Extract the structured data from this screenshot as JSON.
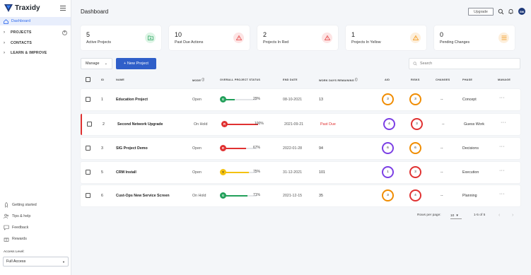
{
  "app": {
    "name": "Traxidy"
  },
  "sidebar": {
    "items": [
      {
        "label": "Dashboard"
      },
      {
        "label": "PROJECTS"
      },
      {
        "label": "CONTACTS"
      },
      {
        "label": "LEARN & IMPROVE"
      }
    ],
    "utilities": [
      {
        "label": "Getting started",
        "icon": "rocket-icon"
      },
      {
        "label": "Tips & help",
        "icon": "people-icon"
      },
      {
        "label": "Feedback",
        "icon": "chat-icon"
      },
      {
        "label": "Rewards",
        "icon": "gift-icon"
      }
    ],
    "access_label": "Access Level:",
    "access_value": "Full Access"
  },
  "header": {
    "title": "Dashboard",
    "upgrade_label": "Upgrade",
    "avatar_initials": "SM"
  },
  "cards": [
    {
      "number": "5",
      "label": "Active Projects",
      "icon": "folder-icon",
      "color": "#22a05a",
      "bg": "#def5e6"
    },
    {
      "number": "10",
      "label": "Past Due Actions",
      "icon": "warning-icon",
      "color": "#e03131",
      "bg": "#fde4e4"
    },
    {
      "number": "2",
      "label": "Projects In Red",
      "icon": "warning-icon",
      "color": "#e03131",
      "bg": "#fde4e4"
    },
    {
      "number": "1",
      "label": "Projects In Yellow",
      "icon": "warning-icon",
      "color": "#f08c00",
      "bg": "#fdefdc"
    },
    {
      "number": "0",
      "label": "Pending Changes",
      "icon": "list-icon",
      "color": "#f08c00",
      "bg": "#fdefdc"
    }
  ],
  "toolbar": {
    "manage_label": "Manage",
    "new_project_label": "+ New Project",
    "search_placeholder": "Search"
  },
  "table": {
    "headers": [
      "ID",
      "NAME",
      "MODE",
      "OVERALL PROJECT STATUS",
      "END DATE",
      "WORK DAYS REMAINING",
      "AID",
      "RISKS",
      "CHANGES",
      "PHASE",
      "MANAGE"
    ],
    "rows": [
      {
        "id": "1",
        "name": "Education Project",
        "mode": "Open",
        "status_letter": "G",
        "status_color": "#22a05a",
        "pct": "29%",
        "pct_value": 29,
        "end": "08-10-2021",
        "end_red": false,
        "days": "13",
        "days_red": false,
        "aid": "3",
        "aid_color": "#f08c00",
        "risks": "3",
        "risks_color": "#f08c00",
        "changes": "--",
        "phase": "Concept",
        "manage": "···",
        "flag": false
      },
      {
        "id": "2",
        "name": "Second Network Upgrade",
        "mode": "On Hold",
        "status_letter": "R",
        "status_color": "#e03131",
        "pct": "100%",
        "pct_value": 100,
        "end": "2021-09-21",
        "end_red": false,
        "days": "Past Due",
        "days_red": true,
        "aid": "4",
        "aid_color": "#7b3fe4",
        "risks": "3",
        "risks_color": "#e03131",
        "changes": "--",
        "phase": "Guess Work",
        "manage": "···",
        "flag": true
      },
      {
        "id": "3",
        "name": "SIG Project Demo",
        "mode": "Open",
        "status_letter": "R",
        "status_color": "#e03131",
        "pct": "67%",
        "pct_value": 67,
        "end": "2022-01-28",
        "end_red": false,
        "days": "94",
        "days_red": false,
        "aid": "6",
        "aid_color": "#7b3fe4",
        "risks": "6",
        "risks_color": "#f08c00",
        "changes": "--",
        "phase": "Decisions",
        "manage": "···",
        "flag": false
      },
      {
        "id": "5",
        "name": "CRM Install",
        "mode": "Open",
        "status_letter": "Y",
        "status_color": "#f4c20d",
        "pct": "75%",
        "pct_value": 75,
        "end": "31-12-2021",
        "end_red": false,
        "days": "101",
        "days_red": false,
        "aid": "1",
        "aid_color": "#7b3fe4",
        "risks": "3",
        "risks_color": "#e03131",
        "changes": "--",
        "phase": "Execution",
        "manage": "···",
        "flag": false
      },
      {
        "id": "6",
        "name": "Cust-Ops New Service Screen",
        "mode": "On Hold",
        "status_letter": "G",
        "status_color": "#22a05a",
        "pct": "71%",
        "pct_value": 71,
        "end": "2021-12-15",
        "end_red": false,
        "days": "35",
        "days_red": false,
        "aid": "3",
        "aid_color": "#f08c00",
        "risks": "4",
        "risks_color": "#e03131",
        "changes": "--",
        "phase": "Planning",
        "manage": "···",
        "flag": false
      }
    ]
  },
  "pagination": {
    "rows_label": "Rows per page:",
    "rows_value": "10",
    "range": "1-5 of 5"
  }
}
